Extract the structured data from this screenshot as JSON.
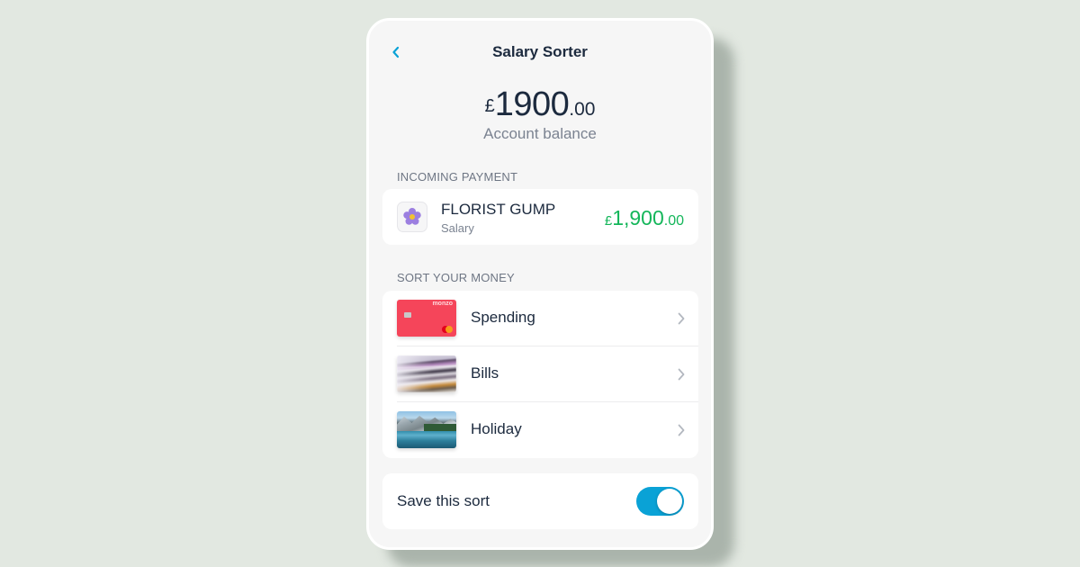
{
  "header": {
    "title": "Salary Sorter",
    "back_icon": "chevron-left-icon"
  },
  "balance": {
    "currency": "£",
    "whole": "1900",
    "decimal": ".00",
    "label": "Account balance"
  },
  "incoming": {
    "section_label": "INCOMING PAYMENT",
    "payee": "FLORIST GUMP",
    "category": "Salary",
    "icon": "flower-icon",
    "amount_currency": "£",
    "amount_whole": "1,900",
    "amount_decimal": ".00",
    "amount_color": "#14b65a"
  },
  "sort": {
    "section_label": "SORT YOUR MONEY",
    "items": [
      {
        "label": "Spending",
        "thumbnail": "monzo-card-image",
        "brand": "monzo"
      },
      {
        "label": "Bills",
        "thumbnail": "bills-paper-stack-image"
      },
      {
        "label": "Holiday",
        "thumbnail": "mountain-lake-image"
      }
    ]
  },
  "save_sort": {
    "label": "Save this sort",
    "enabled": true,
    "toggle_color": "#0aa2d6"
  },
  "colors": {
    "background": "#e2e8e1",
    "screen": "#f6f6f6",
    "text": "#1c2a3e",
    "accent": "#0aa2d6"
  }
}
